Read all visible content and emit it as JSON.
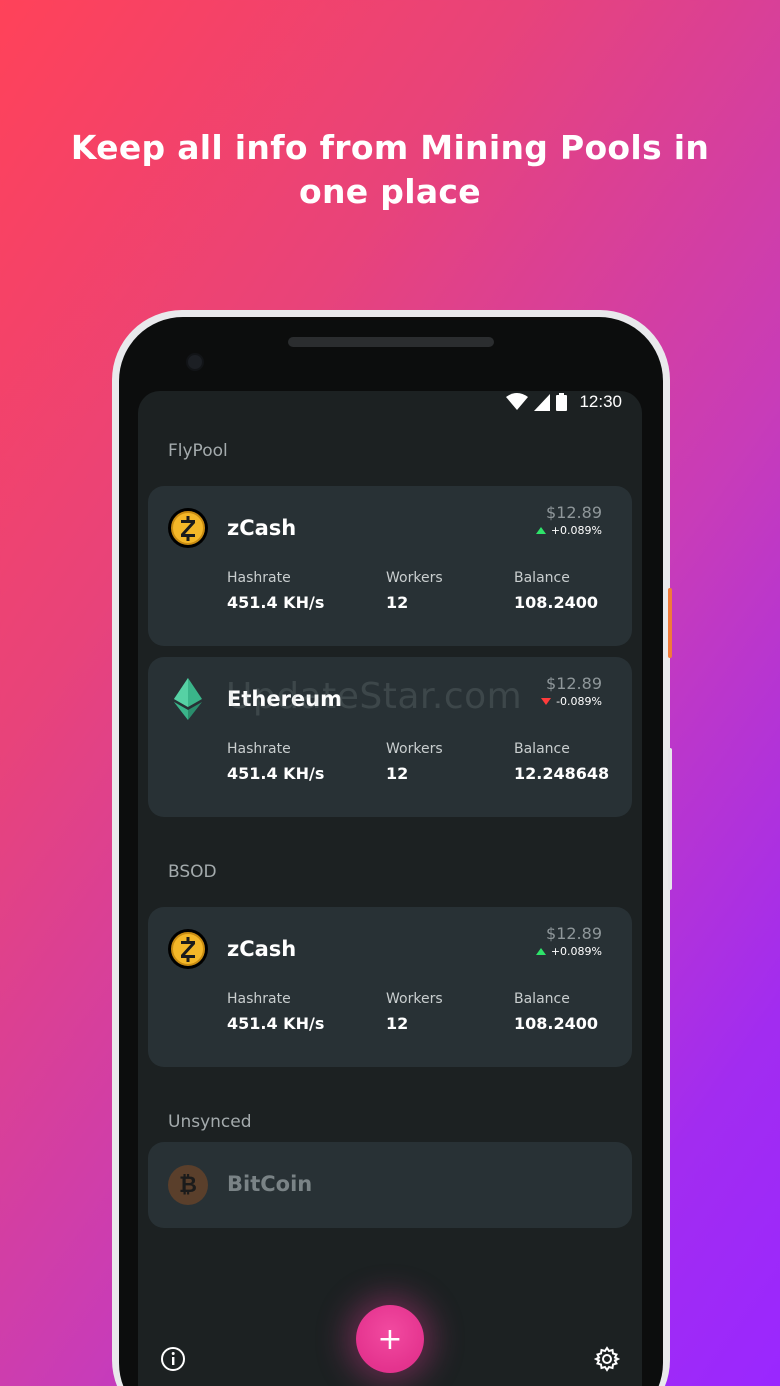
{
  "headline": "Keep all info from Mining Pools in one place",
  "status_bar": {
    "time": "12:30",
    "icons": [
      "wifi-icon",
      "signal-icon",
      "battery-icon"
    ]
  },
  "watermark": "UpdateStar.com",
  "sections": [
    {
      "title": "FlyPool",
      "cards": [
        {
          "icon": "zcash-icon",
          "name": "zCash",
          "price": "$12.89",
          "change": "+0.089%",
          "trend": "up",
          "hashrate_label": "Hashrate",
          "hashrate": "451.4 KH/s",
          "workers_label": "Workers",
          "workers": "12",
          "balance_label": "Balance",
          "balance": "108.2400"
        },
        {
          "icon": "ethereum-icon",
          "name": "Ethereum",
          "price": "$12.89",
          "change": "-0.089%",
          "trend": "down",
          "hashrate_label": "Hashrate",
          "hashrate": "451.4 KH/s",
          "workers_label": "Workers",
          "workers": "12",
          "balance_label": "Balance",
          "balance": "12.248648"
        }
      ]
    },
    {
      "title": "BSOD",
      "cards": [
        {
          "icon": "zcash-icon",
          "name": "zCash",
          "price": "$12.89",
          "change": "+0.089%",
          "trend": "up",
          "hashrate_label": "Hashrate",
          "hashrate": "451.4 KH/s",
          "workers_label": "Workers",
          "workers": "12",
          "balance_label": "Balance",
          "balance": "108.2400"
        }
      ]
    },
    {
      "title": "Unsynced",
      "cards": [
        {
          "icon": "bitcoin-icon",
          "name": "BitCoin"
        }
      ]
    }
  ],
  "bottom_bar": {
    "info_icon": "info-icon",
    "add_label": "+",
    "settings_icon": "gear-icon"
  },
  "colors": {
    "accent": "#e4338e",
    "card": "#283135",
    "screen": "#1c2122",
    "up": "#2ee36a",
    "down": "#ff3b3b"
  }
}
